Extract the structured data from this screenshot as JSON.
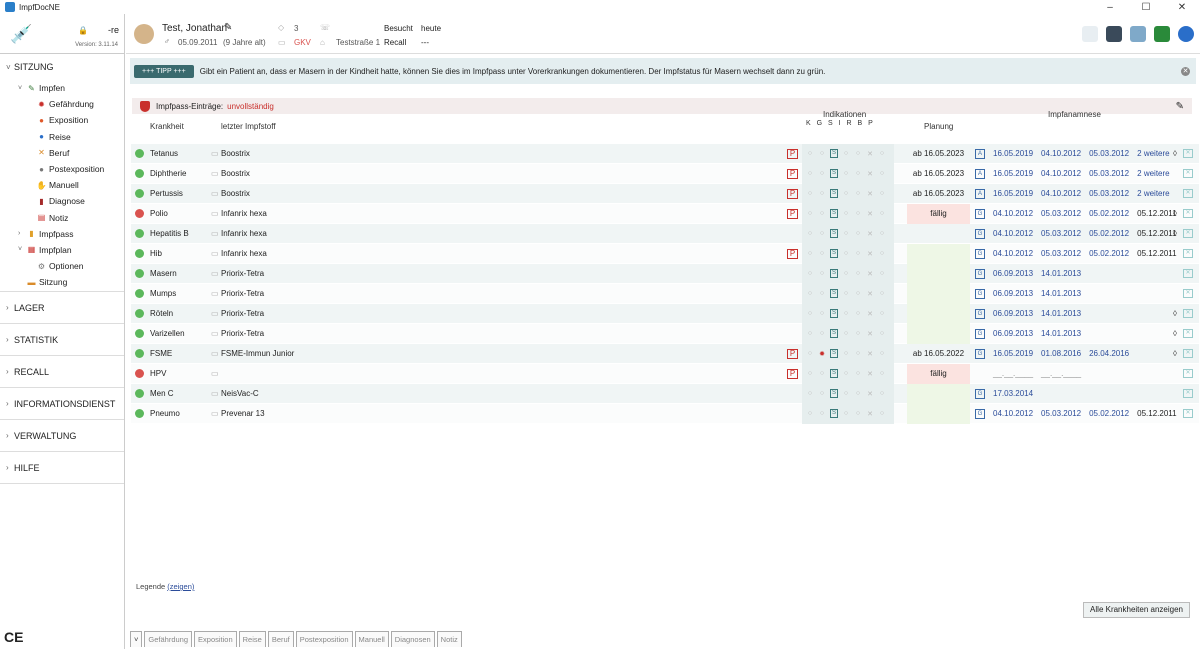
{
  "window": {
    "title": "ImpfDocNE"
  },
  "sidebar": {
    "user": "-re",
    "version": "Version: 3.11.14",
    "sections": [
      "SITZUNG",
      "LAGER",
      "STATISTIK",
      "RECALL",
      "INFORMATIONSDIENST",
      "VERWALTUNG",
      "HILFE"
    ],
    "tree": {
      "impfen": "Impfen",
      "children": [
        "Gefährdung",
        "Exposition",
        "Reise",
        "Beruf",
        "Postexposition",
        "Manuell",
        "Diagnose",
        "Notiz"
      ],
      "impfpass": "Impfpass",
      "impfplan": "Impfplan",
      "optionen": "Optionen",
      "sitzung": "Sitzung"
    },
    "ce": "CE"
  },
  "patient": {
    "name": "Test, Jonathan",
    "birth": "05.09.2011",
    "age": "(9 Jahre alt)",
    "count": "3",
    "insurance": "GKV",
    "address": "Teststraße 1",
    "visited_label": "Besucht",
    "visited_value": "heute",
    "recall_label": "Recall",
    "recall_value": "---"
  },
  "tip": {
    "badge": "+++ TIPP +++",
    "text": "Gibt ein Patient an, dass er Masern in der Kindheit hatte, können Sie dies im Impfpass unter Vorerkrankungen dokumentieren. Der Impfstatus für Masern wechselt dann zu grün."
  },
  "entries": {
    "label": "Impfpass-Einträge:",
    "status": "unvollständig"
  },
  "columns": {
    "krankheit": "Krankheit",
    "impfstoff": "letzter Impfstoff",
    "indikationen": "Indikationen",
    "indic_letters": "K G S I R B P",
    "planung": "Planung",
    "impfanamnese": "Impfanamnese"
  },
  "rows": [
    {
      "k": "Tetanus",
      "v": "Boostrix",
      "ok": true,
      "pass": true,
      "plan": "ab 16.05.2023",
      "pt": "",
      "tag": "A",
      "dates": [
        "16.05.2019",
        "04.10.2012",
        "05.03.2012",
        "2 weitere"
      ],
      "drop": true
    },
    {
      "k": "Diphtherie",
      "v": "Boostrix",
      "ok": true,
      "pass": true,
      "plan": "ab 16.05.2023",
      "pt": "",
      "tag": "A",
      "dates": [
        "16.05.2019",
        "04.10.2012",
        "05.03.2012",
        "2 weitere"
      ],
      "drop": false
    },
    {
      "k": "Pertussis",
      "v": "Boostrix",
      "ok": true,
      "pass": true,
      "plan": "ab 16.05.2023",
      "pt": "",
      "tag": "A",
      "dates": [
        "16.05.2019",
        "04.10.2012",
        "05.03.2012",
        "2 weitere"
      ],
      "drop": false
    },
    {
      "k": "Polio",
      "v": "Infanrix hexa",
      "ok": false,
      "pass": true,
      "plan": "fällig",
      "pt": "red",
      "tag": "G",
      "dates": [
        "04.10.2012",
        "05.03.2012",
        "05.02.2012",
        "05.12.2011"
      ],
      "drop": true
    },
    {
      "k": "Hepatitis B",
      "v": "Infanrix hexa",
      "ok": true,
      "pass": false,
      "plan": "",
      "pt": "",
      "tag": "G",
      "dates": [
        "04.10.2012",
        "05.03.2012",
        "05.02.2012",
        "05.12.2011"
      ],
      "drop": true
    },
    {
      "k": "Hib",
      "v": "Infanrix hexa",
      "ok": true,
      "pass": true,
      "plan": "",
      "pt": "green",
      "tag": "G",
      "dates": [
        "04.10.2012",
        "05.03.2012",
        "05.02.2012",
        "05.12.2011"
      ],
      "drop": false
    },
    {
      "k": "Masern",
      "v": "Priorix-Tetra",
      "ok": true,
      "pass": false,
      "plan": "",
      "pt": "green",
      "tag": "G",
      "dates": [
        "06.09.2013",
        "14.01.2013"
      ],
      "drop": false
    },
    {
      "k": "Mumps",
      "v": "Priorix-Tetra",
      "ok": true,
      "pass": false,
      "plan": "",
      "pt": "green",
      "tag": "G",
      "dates": [
        "06.09.2013",
        "14.01.2013"
      ],
      "drop": false
    },
    {
      "k": "Röteln",
      "v": "Priorix-Tetra",
      "ok": true,
      "pass": false,
      "plan": "",
      "pt": "green",
      "tag": "G",
      "dates": [
        "06.09.2013",
        "14.01.2013"
      ],
      "drop": true
    },
    {
      "k": "Varizellen",
      "v": "Priorix-Tetra",
      "ok": true,
      "pass": false,
      "plan": "",
      "pt": "green",
      "tag": "G",
      "dates": [
        "06.09.2013",
        "14.01.2013"
      ],
      "drop": true
    },
    {
      "k": "FSME",
      "v": "FSME-Immun Junior",
      "ok": true,
      "pass": true,
      "plan": "ab 16.05.2022",
      "pt": "",
      "tag": "G",
      "dates": [
        "16.05.2019",
        "01.08.2016",
        "26.04.2016"
      ],
      "drop": true
    },
    {
      "k": "HPV",
      "v": "",
      "ok": false,
      "pass": true,
      "plan": "fällig",
      "pt": "red",
      "tag": "",
      "dates": [
        "__.__.____",
        "__.__.____"
      ],
      "drop": false
    },
    {
      "k": "Men C",
      "v": "NeisVac-C",
      "ok": true,
      "pass": false,
      "plan": "",
      "pt": "green",
      "tag": "G",
      "dates": [
        "17.03.2014"
      ],
      "drop": false
    },
    {
      "k": "Pneumo",
      "v": "Prevenar 13",
      "ok": true,
      "pass": false,
      "plan": "",
      "pt": "green",
      "tag": "G",
      "dates": [
        "04.10.2012",
        "05.03.2012",
        "05.02.2012",
        "05.12.2011"
      ],
      "drop": false
    }
  ],
  "legend": {
    "label": "Legende",
    "link": "(zeigen)"
  },
  "all_button": "Alle Krankheiten anzeigen",
  "bottom_tabs": [
    "Gefährdung",
    "Exposition",
    "Reise",
    "Beruf",
    "Postexposition",
    "Manuell",
    "Diagnosen",
    "Notiz"
  ],
  "colors": {
    "accent": "#3a6a6e",
    "red": "#d9534f",
    "green": "#5cb85c",
    "date": "#2b4c9a"
  }
}
